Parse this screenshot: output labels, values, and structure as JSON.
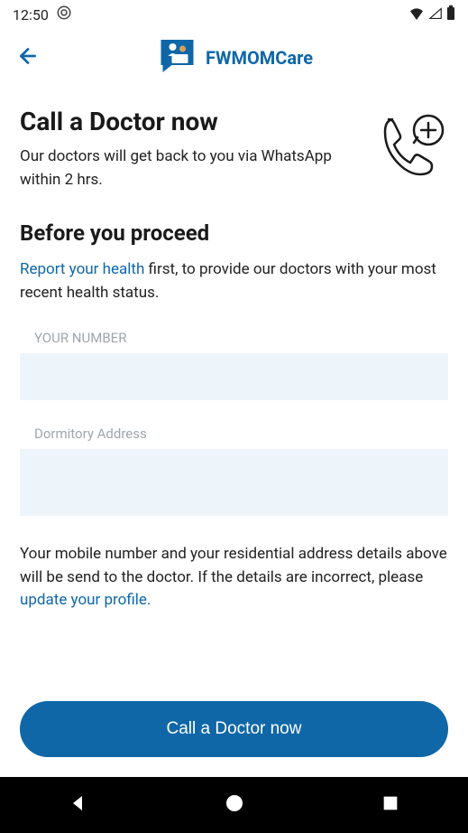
{
  "status_bar": {
    "time": "12:50"
  },
  "header": {
    "app_name": "FWMOMCare"
  },
  "main": {
    "title": "Call a Doctor now",
    "subtitle": "Our doctors will get back to you via WhatsApp within 2 hrs.",
    "before_heading": "Before you proceed",
    "report_link": "Report your health",
    "report_text_after": " first, to provide our doctors with your most recent health status.",
    "number_label": "YOUR NUMBER",
    "number_value": "",
    "address_label": "Dormitory Address",
    "address_value": "",
    "info_text_before": "Your mobile number and your residential address details above will be send to the doctor. If the details are incorrect, please ",
    "update_link": "update your profile.",
    "cta_label": "Call a Doctor now"
  }
}
